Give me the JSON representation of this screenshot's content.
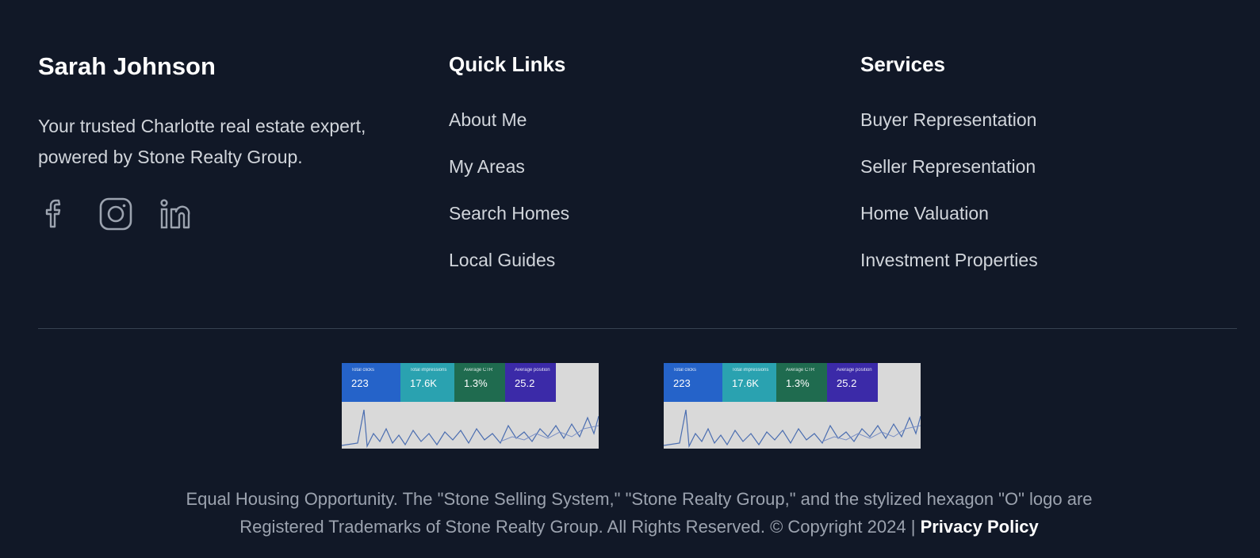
{
  "brand": {
    "name": "Sarah Johnson",
    "tagline": "Your trusted Charlotte real estate expert, powered by Stone Realty Group."
  },
  "socials": [
    {
      "icon": "facebook-icon"
    },
    {
      "icon": "instagram-icon"
    },
    {
      "icon": "linkedin-icon"
    }
  ],
  "quick_links": {
    "title": "Quick Links",
    "items": [
      "About Me",
      "My Areas",
      "Search Homes",
      "Local Guides"
    ]
  },
  "services": {
    "title": "Services",
    "items": [
      "Buyer Representation",
      "Seller Representation",
      "Home Valuation",
      "Investment Properties"
    ]
  },
  "thumbnails": [
    {
      "tiles": [
        {
          "label": "Total clicks",
          "value": "223",
          "color": "#2563c9"
        },
        {
          "label": "Total impressions",
          "value": "17.6K",
          "color": "#2aa2b0"
        },
        {
          "label": "Average CTR",
          "value": "1.3%",
          "color": "#1f6b4f"
        },
        {
          "label": "Average position",
          "value": "25.2",
          "color": "#3b2aa8"
        }
      ]
    },
    {
      "tiles": [
        {
          "label": "Total clicks",
          "value": "223",
          "color": "#2563c9"
        },
        {
          "label": "Total impressions",
          "value": "17.6K",
          "color": "#2aa2b0"
        },
        {
          "label": "Average CTR",
          "value": "1.3%",
          "color": "#1f6b4f"
        },
        {
          "label": "Average position",
          "value": "25.2",
          "color": "#3b2aa8"
        }
      ]
    }
  ],
  "legal": {
    "line1": "Equal Housing Opportunity. The \"Stone Selling System,\" \"Stone Realty Group,\" and the stylized hexagon \"O\" logo are",
    "line2": "Registered Trademarks of Stone Realty Group. All Rights Reserved. © Copyright 2024 |",
    "privacy_label": "Privacy Policy"
  },
  "colors": {
    "background": "#111827",
    "text": "#d1d5db",
    "heading": "#ffffff",
    "divider": "#374151"
  }
}
